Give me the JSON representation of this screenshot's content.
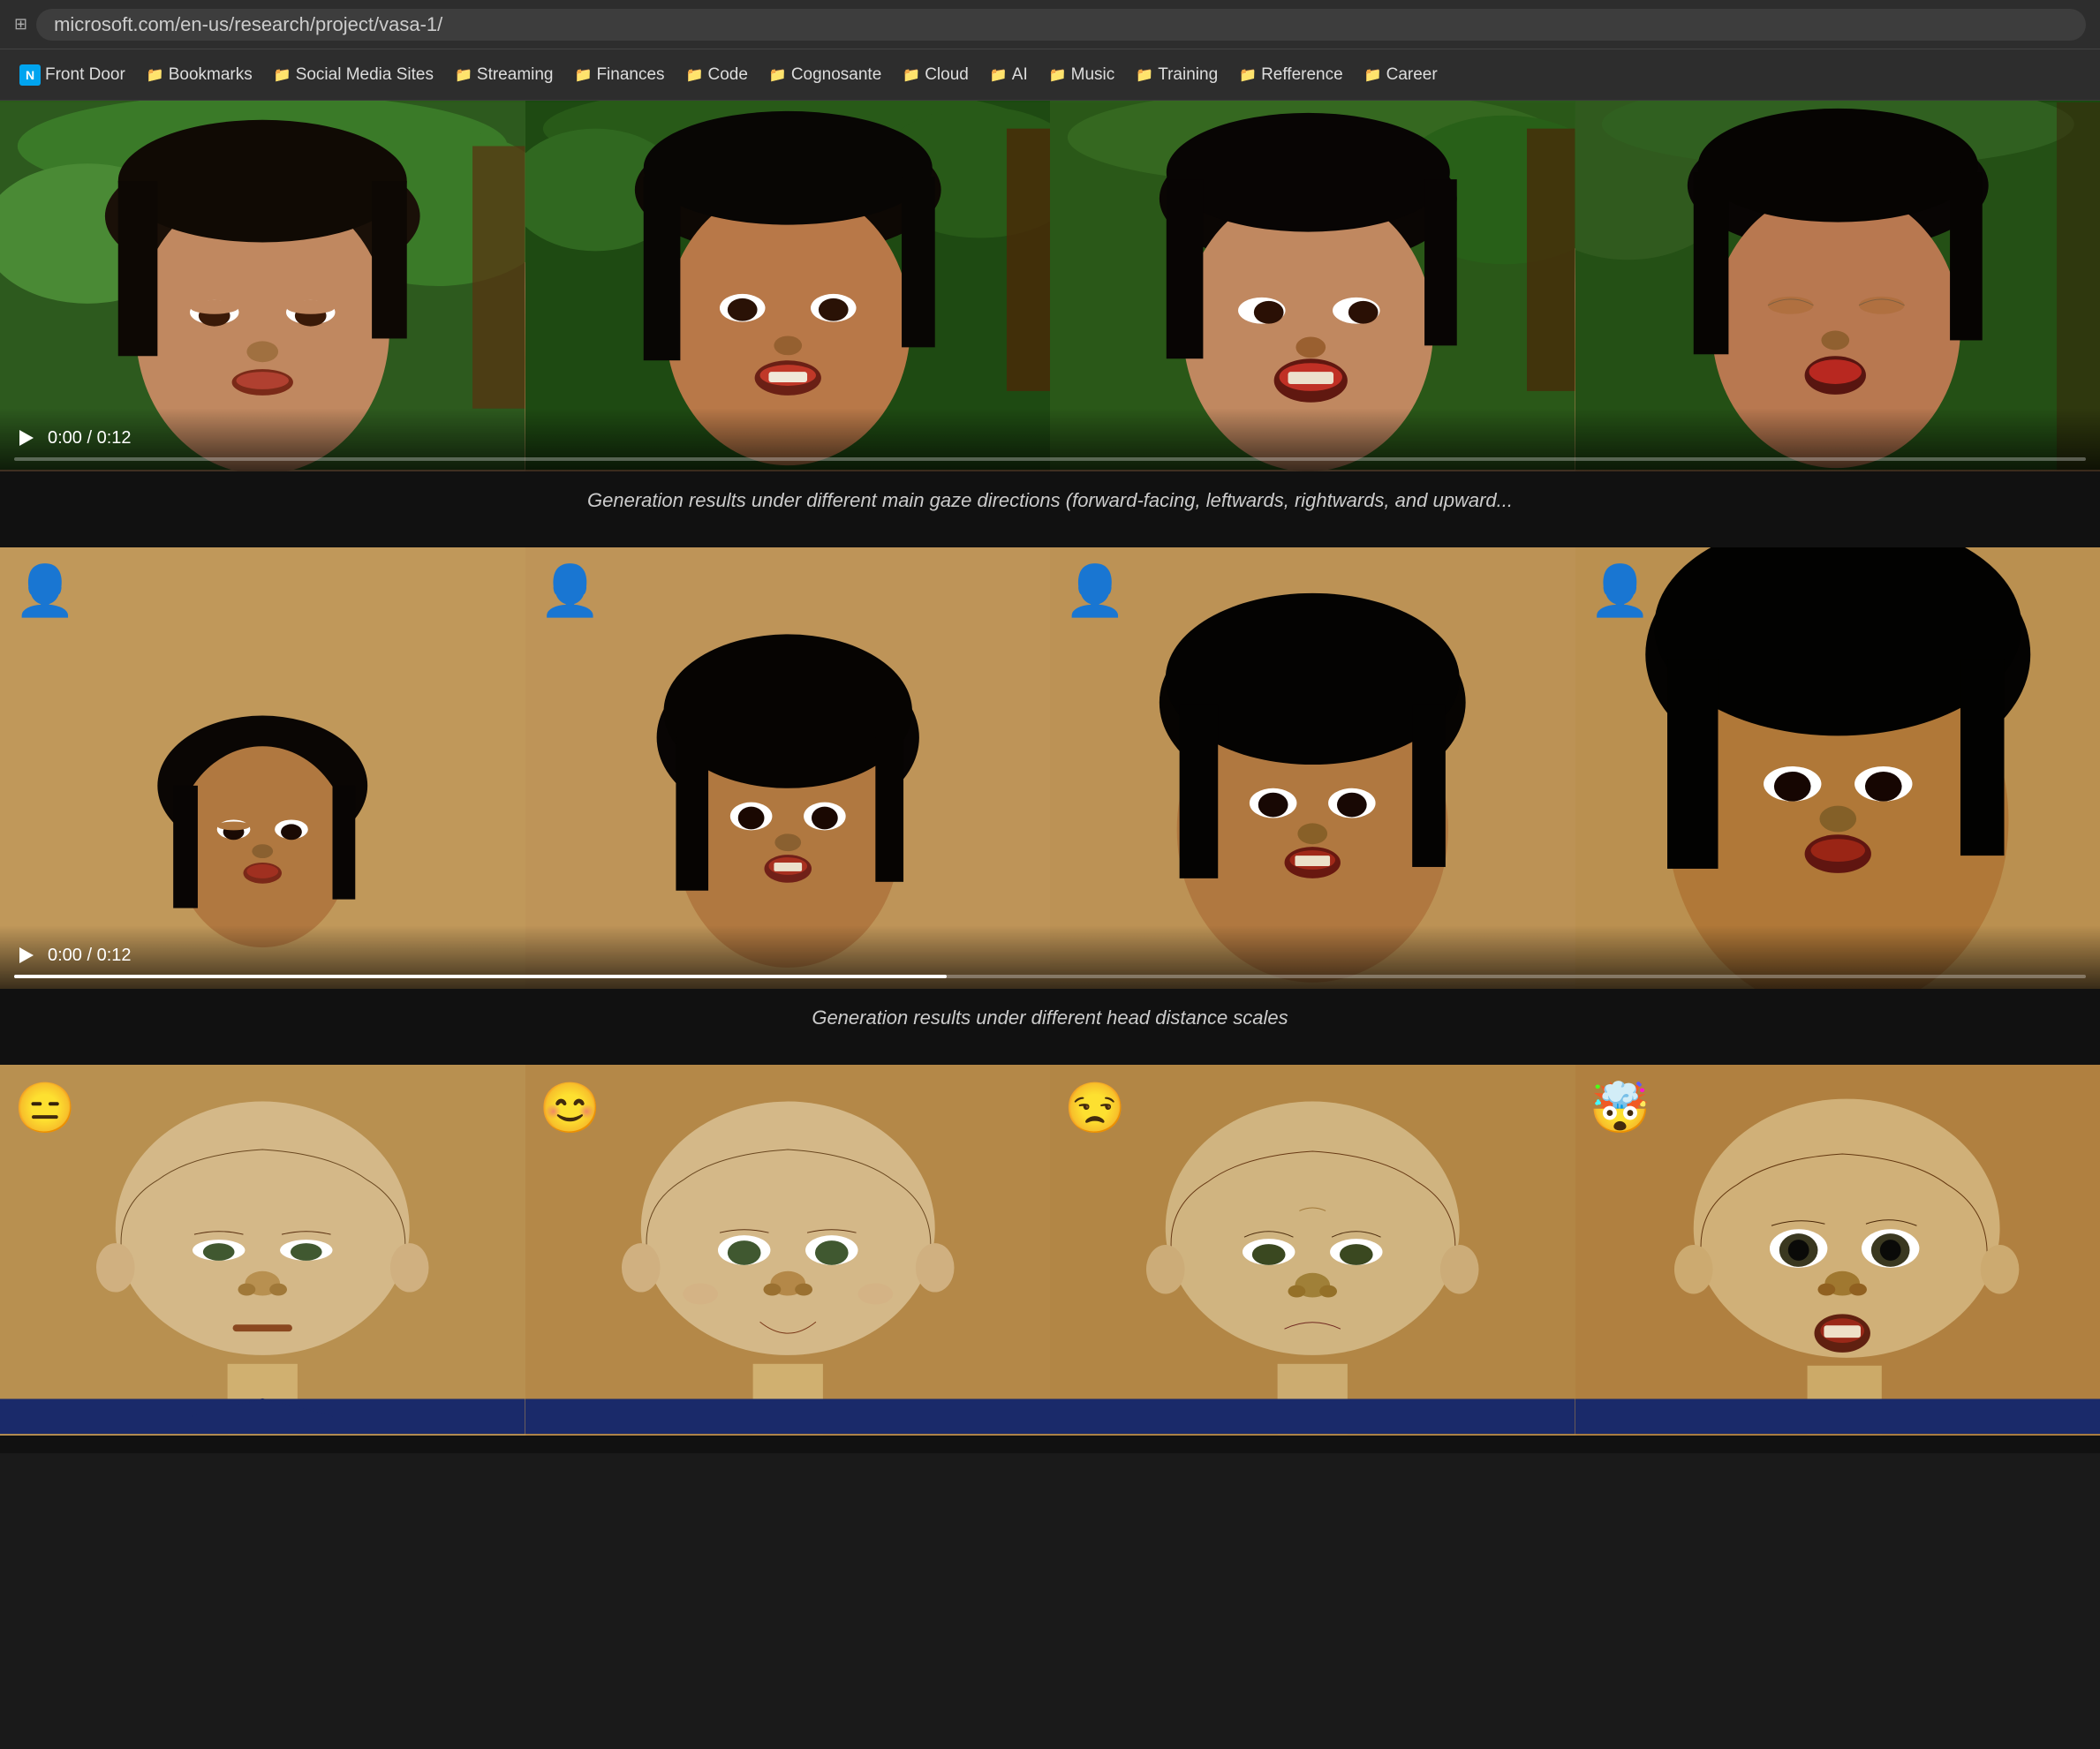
{
  "browser": {
    "address": "microsoft.com/en-us/research/project/vasa-1/",
    "address_icon": "⊞"
  },
  "bookmarks": {
    "items": [
      {
        "label": "Front Door",
        "icon": "N",
        "type": "logo"
      },
      {
        "label": "Bookmarks",
        "icon": "📁"
      },
      {
        "label": "Social Media Sites",
        "icon": "📁"
      },
      {
        "label": "Streaming",
        "icon": "📁"
      },
      {
        "label": "Finances",
        "icon": "📁"
      },
      {
        "label": "Code",
        "icon": "📁"
      },
      {
        "label": "Cognosante",
        "icon": "📁"
      },
      {
        "label": "Cloud",
        "icon": "📁"
      },
      {
        "label": "AI",
        "icon": "📁"
      },
      {
        "label": "Music",
        "icon": "📁"
      },
      {
        "label": "Training",
        "icon": "📁"
      },
      {
        "label": "Refference",
        "icon": "📁"
      },
      {
        "label": "Career",
        "icon": "📁"
      }
    ]
  },
  "videos": {
    "video1": {
      "time": "0:00 / 0:12",
      "progress": 0,
      "caption": "Generation results under different main gaze directions (forward-facing, leftwards, rightwards, and upward..."
    },
    "video2": {
      "time": "0:00 / 0:12",
      "progress": 45,
      "caption": "Generation results under different head distance scales",
      "user_icons": [
        "👤",
        "👤",
        "👤",
        "👤"
      ]
    },
    "video3": {
      "caption": "",
      "emojis": [
        "😑",
        "😊",
        "😒",
        "🤯"
      ]
    }
  }
}
